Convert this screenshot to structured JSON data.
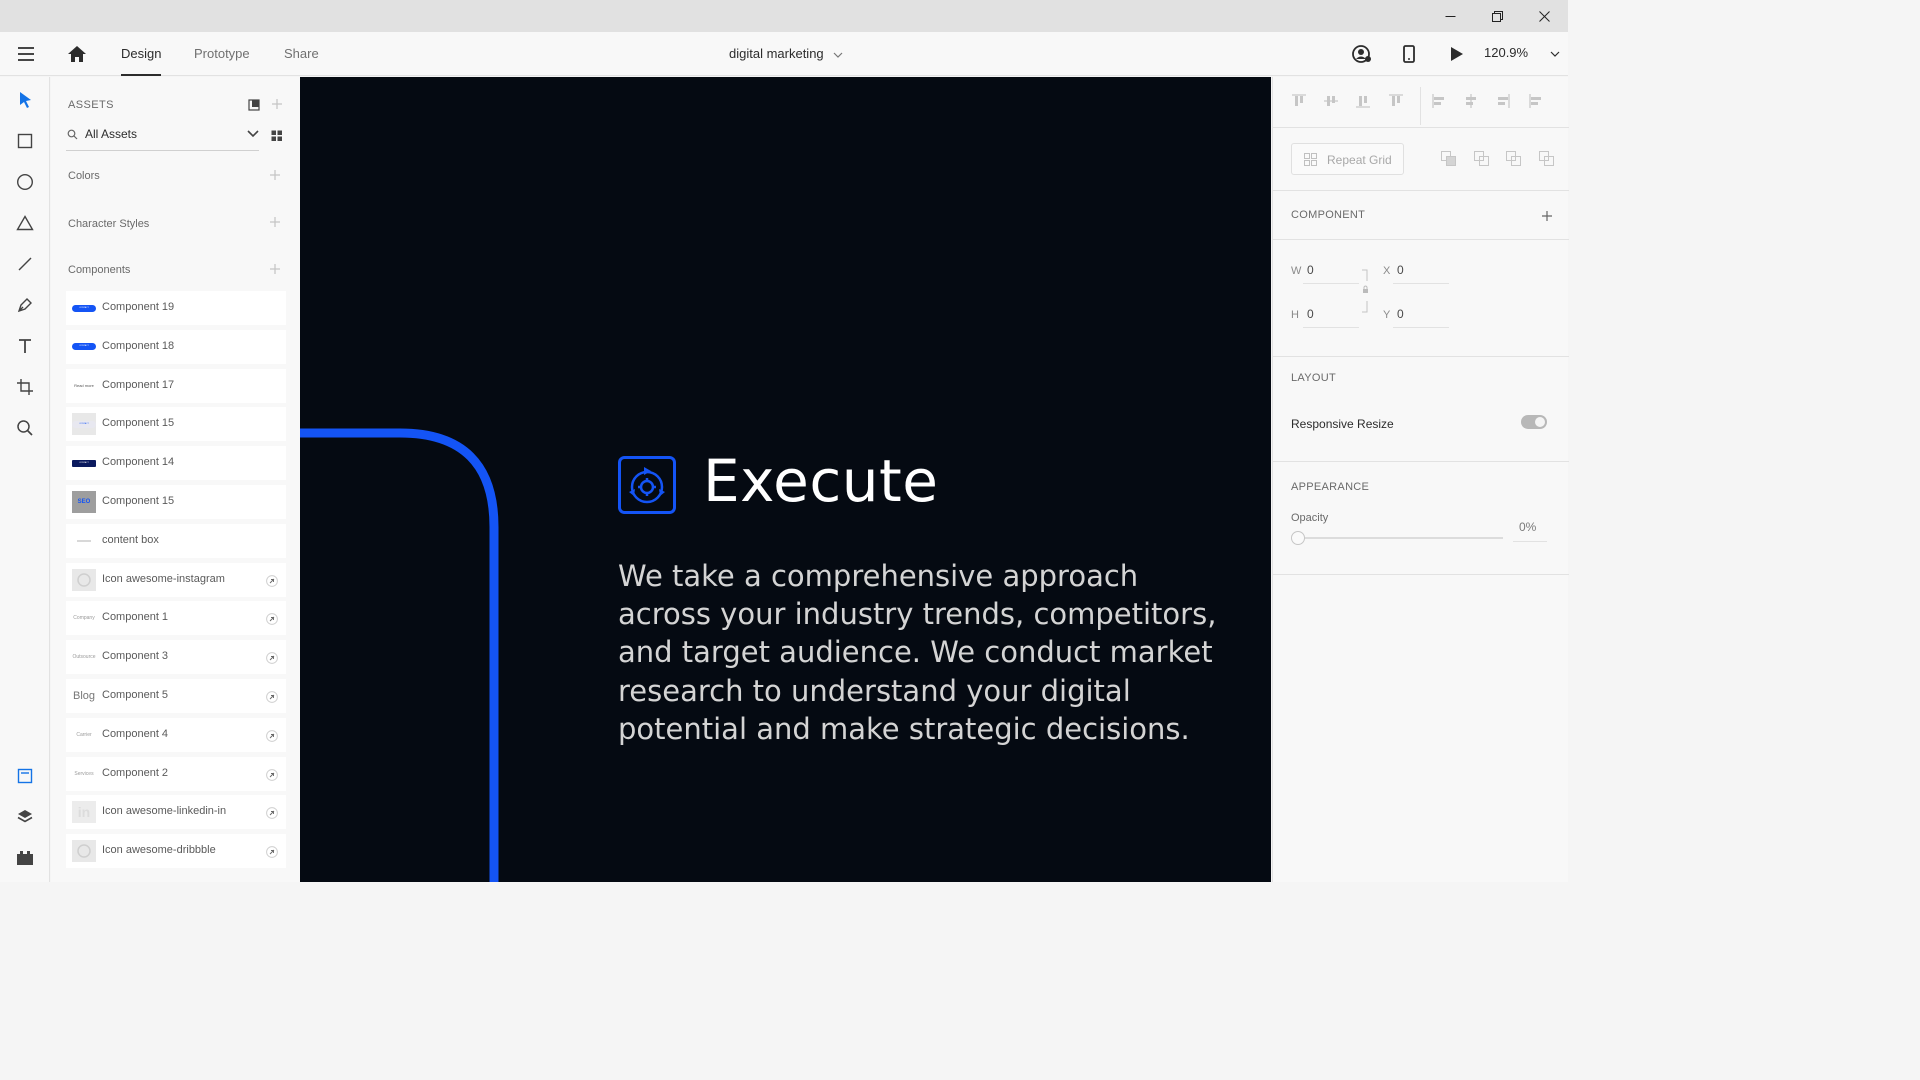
{
  "window": {
    "minimize_icon": "minimize-icon",
    "restore_icon": "restore-icon",
    "close_icon": "close-icon"
  },
  "topbar": {
    "tabs": [
      "Design",
      "Prototype",
      "Share"
    ],
    "active_tab": "Design",
    "doc_title": "digital marketing",
    "zoom": "120.9%"
  },
  "assets": {
    "header": "ASSETS",
    "search_value": "All Assets",
    "sections": {
      "colors": "Colors",
      "character_styles": "Character Styles",
      "components": "Components"
    },
    "components": [
      {
        "label": "Component 19",
        "thumb": "CONTACT",
        "linked": false
      },
      {
        "label": "Component 18",
        "thumb": "CONTACT",
        "linked": false
      },
      {
        "label": "Component 17",
        "thumb": "Read more",
        "linked": false
      },
      {
        "label": "Component 15",
        "thumb": "CONTACT",
        "linked": false
      },
      {
        "label": "Component 14",
        "thumb": "CONTACT",
        "linked": false
      },
      {
        "label": "Component 15",
        "thumb": "SEO",
        "linked": false
      },
      {
        "label": "content box",
        "thumb": "",
        "linked": false
      },
      {
        "label": "Icon awesome-instagram",
        "thumb": "",
        "linked": true
      },
      {
        "label": "Component 1",
        "thumb": "Company",
        "linked": true
      },
      {
        "label": "Component 3",
        "thumb": "Outsource",
        "linked": true
      },
      {
        "label": "Component 5",
        "thumb": "Blog",
        "linked": true
      },
      {
        "label": "Component 4",
        "thumb": "Carrier",
        "linked": true
      },
      {
        "label": "Component 2",
        "thumb": "Services",
        "linked": true
      },
      {
        "label": "Icon awesome-linkedin-in",
        "thumb": "in",
        "linked": true
      },
      {
        "label": "Icon awesome-dribbble",
        "thumb": "",
        "linked": true
      }
    ]
  },
  "canvas": {
    "title": "Execute",
    "body": "We take a comprehensive approach across your industry trends, competitors, and target audience. We conduct market research to understand your digital potential and make strategic decisions.",
    "accent_color": "#1454f5",
    "background_color": "#050a12"
  },
  "properties": {
    "repeat_grid": "Repeat Grid",
    "component_title": "COMPONENT",
    "w_label": "W",
    "w_value": "0",
    "h_label": "H",
    "h_value": "0",
    "x_label": "X",
    "x_value": "0",
    "y_label": "Y",
    "y_value": "0",
    "layout_title": "LAYOUT",
    "responsive_resize": "Responsive Resize",
    "responsive_resize_on": false,
    "appearance_title": "APPEARANCE",
    "opacity_label": "Opacity",
    "opacity_value": "0%",
    "opacity": 0
  }
}
